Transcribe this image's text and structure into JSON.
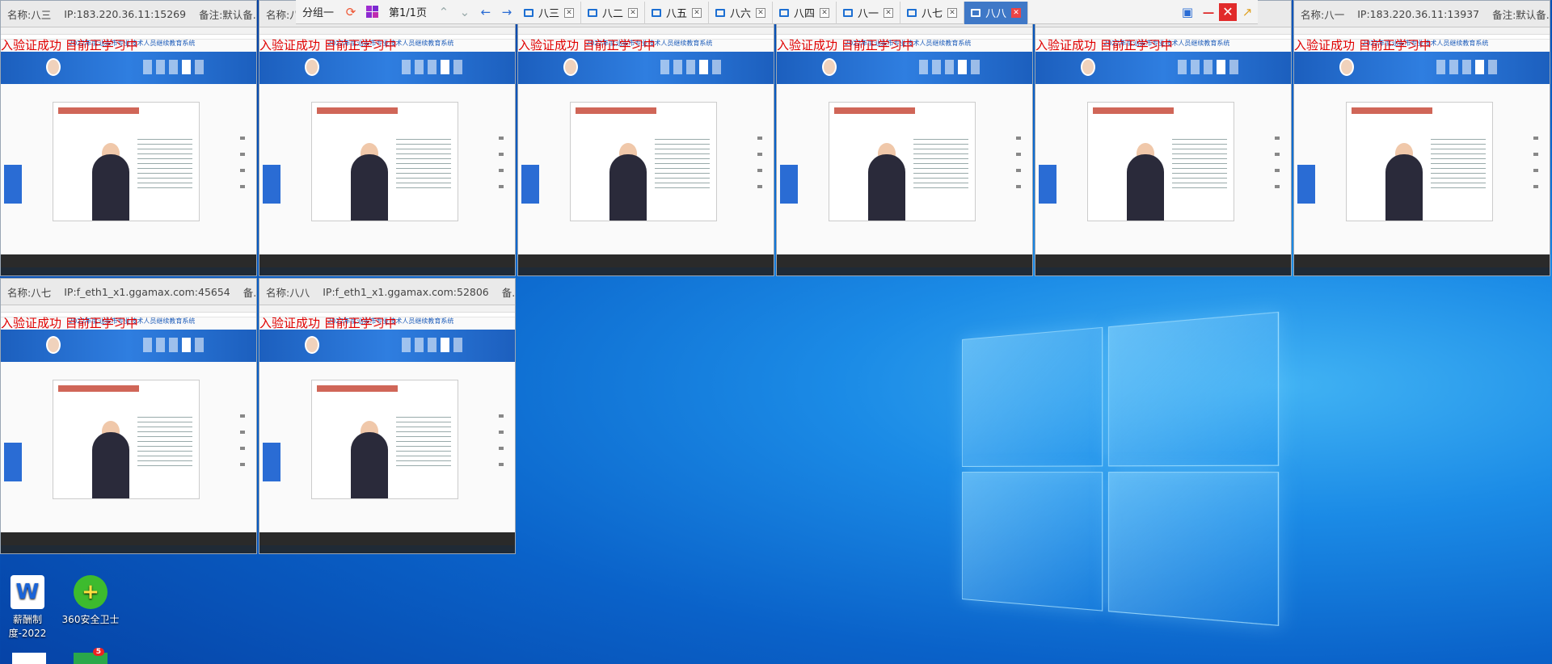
{
  "desktop": {
    "icons": [
      {
        "label": "薪酬制度-2022",
        "glyph": "W"
      },
      {
        "label": "360安全卫士",
        "glyph": "+"
      },
      {
        "label": "",
        "glyph": ""
      },
      {
        "label": "",
        "glyph": "",
        "badge": "5"
      }
    ]
  },
  "panel": {
    "group_label": "分组一",
    "page_label": "第1/1页",
    "tabs": [
      {
        "label": "八三"
      },
      {
        "label": "八二"
      },
      {
        "label": "八五"
      },
      {
        "label": "八六"
      },
      {
        "label": "八四"
      },
      {
        "label": "八一"
      },
      {
        "label": "八七"
      },
      {
        "label": "八八",
        "active": true
      }
    ]
  },
  "overlay_text": "入验证成功 目前正学习中",
  "site_title": "2022年度汕头市专业技术人员继续教育系统",
  "windows": [
    {
      "name": "名称:八三",
      "ip": "IP:183.220.36.11:15269",
      "note": "备注:默认备..."
    },
    {
      "name": "名称:八二",
      "ip": "",
      "note": ""
    },
    {
      "name": "",
      "ip": "",
      "note": ""
    },
    {
      "name": "",
      "ip": "",
      "note": ""
    },
    {
      "name": "",
      "ip": "",
      "note": ""
    },
    {
      "name": "名称:八一",
      "ip": "IP:183.220.36.11:13937",
      "note": "备注:默认备..."
    },
    {
      "name": "名称:八七",
      "ip": "IP:f_eth1_x1.ggamax.com:45654",
      "note": "备..."
    },
    {
      "name": "名称:八八",
      "ip": "IP:f_eth1_x1.ggamax.com:52806",
      "note": "备..."
    }
  ],
  "colors": {
    "active_tab": "#3f78c7",
    "overlay_red": "#e00000",
    "banner_blue": "#1c5fbe"
  }
}
